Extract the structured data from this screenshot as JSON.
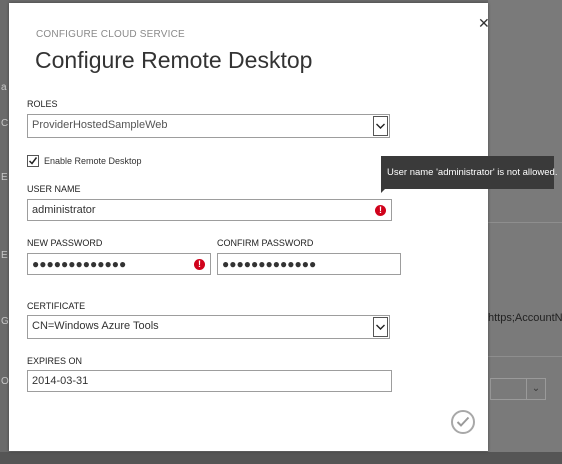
{
  "background": {
    "connection_fragment": "https;AccountNa",
    "left_fragments": [
      "a",
      "C",
      "E",
      "E",
      "G",
      "O"
    ]
  },
  "dialog": {
    "eyebrow": "CONFIGURE CLOUD SERVICE",
    "title": "Configure Remote Desktop",
    "close_icon": "✕",
    "roles": {
      "label": "ROLES",
      "value": "ProviderHostedSampleWeb"
    },
    "enable_remote_desktop": {
      "label": "Enable Remote Desktop",
      "checked": true
    },
    "user_name": {
      "label": "USER NAME",
      "value": "administrator",
      "error_tooltip": "User name 'administrator' is not allowed."
    },
    "new_password": {
      "label": "NEW PASSWORD",
      "value": "●●●●●●●●●●●●●"
    },
    "confirm_password": {
      "label": "CONFIRM PASSWORD",
      "value": "●●●●●●●●●●●●●"
    },
    "certificate": {
      "label": "CERTIFICATE",
      "value": "CN=Windows Azure Tools"
    },
    "expires_on": {
      "label": "EXPIRES ON",
      "value": "2014-03-31"
    }
  },
  "colors": {
    "error": "#d0021b",
    "tooltip_bg": "#3a3a3a",
    "overlay": "#6a6a6a"
  }
}
